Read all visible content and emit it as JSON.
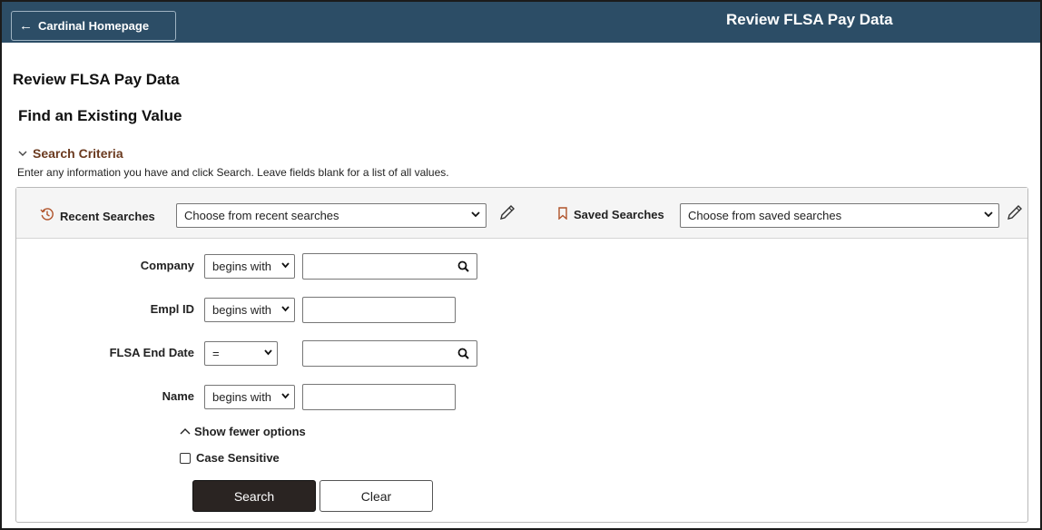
{
  "header": {
    "home_button": "Cardinal Homepage",
    "title": "Review FLSA Pay Data"
  },
  "page": {
    "title": "Review FLSA Pay Data",
    "subtitle": "Find an Existing Value"
  },
  "search_criteria": {
    "toggle_label": "Search Criteria",
    "instructions": "Enter any information you have and click Search. Leave fields blank for a list of all values."
  },
  "recent_searches": {
    "label": "Recent Searches",
    "placeholder": "Choose from recent searches"
  },
  "saved_searches": {
    "label": "Saved Searches",
    "placeholder": "Choose from saved searches"
  },
  "fields": [
    {
      "label": "Company",
      "operator": "begins with",
      "value": "",
      "has_lookup": true
    },
    {
      "label": "Empl ID",
      "operator": "begins with",
      "value": "",
      "has_lookup": false
    },
    {
      "label": "FLSA End Date",
      "operator": "=",
      "value": "",
      "has_lookup": true
    },
    {
      "label": "Name",
      "operator": "begins with",
      "value": "",
      "has_lookup": false
    }
  ],
  "options": {
    "show_fewer": "Show fewer options",
    "case_sensitive": "Case Sensitive",
    "case_sensitive_checked": false
  },
  "buttons": {
    "search": "Search",
    "clear": "Clear"
  },
  "colors": {
    "header_bg": "#2c4d66",
    "accent": "#6b3a1f",
    "search_button_bg": "#2a2422"
  },
  "icons": {
    "back": "arrow-left-icon",
    "recent": "history-icon",
    "saved": "bookmark-icon",
    "edit": "pencil-icon",
    "lookup": "search-icon"
  }
}
